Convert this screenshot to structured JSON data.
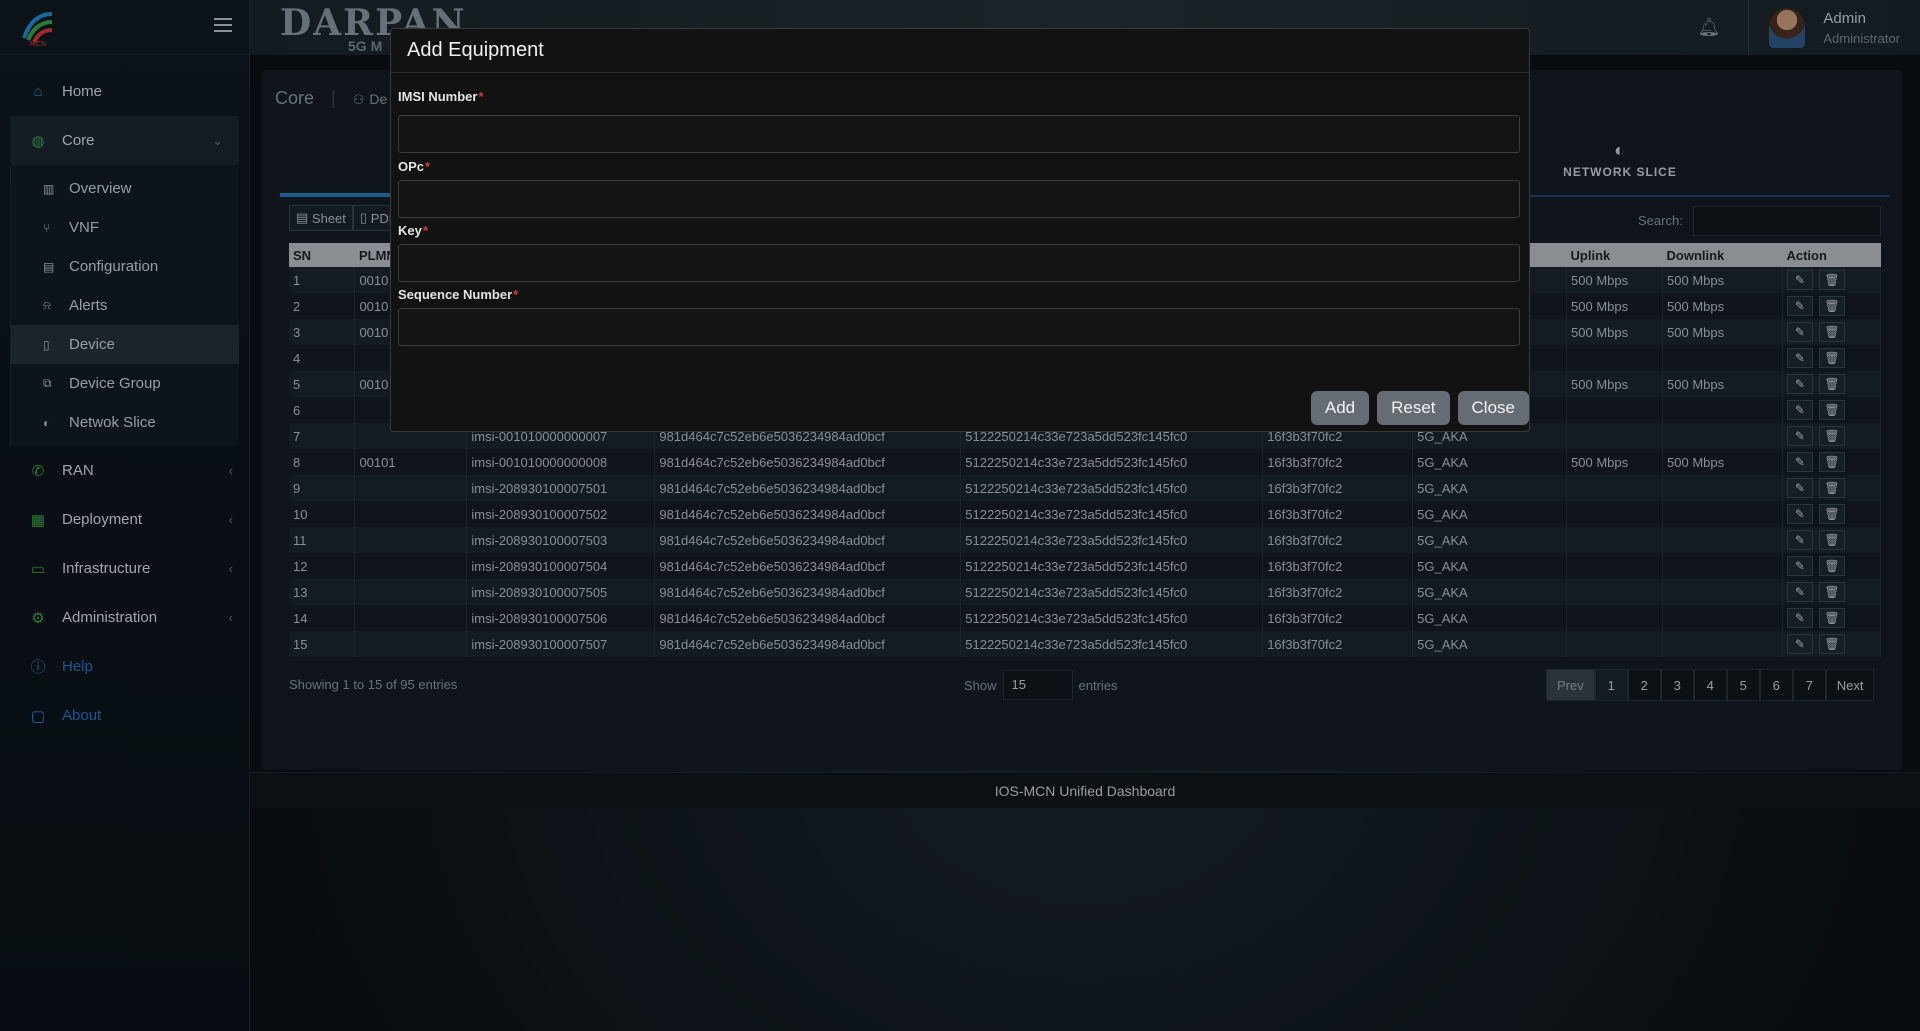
{
  "app": {
    "brand": "DARPAN",
    "brand_sub": "5G M",
    "logo_text": "MCN"
  },
  "sidebar": {
    "items": [
      {
        "label": "Home",
        "icon": "home-icon"
      },
      {
        "label": "Core",
        "icon": "globe-icon"
      },
      {
        "label": "RAN",
        "icon": "signal-icon"
      },
      {
        "label": "Deployment",
        "icon": "grid-icon"
      },
      {
        "label": "Infrastructure",
        "icon": "monitor-icon"
      },
      {
        "label": "Administration",
        "icon": "gear-icon"
      },
      {
        "label": "Help",
        "icon": "help-icon"
      },
      {
        "label": "About",
        "icon": "info-icon"
      }
    ],
    "core_sub": [
      {
        "label": "Overview"
      },
      {
        "label": "VNF"
      },
      {
        "label": "Configuration"
      },
      {
        "label": "Alerts"
      },
      {
        "label": "Device"
      },
      {
        "label": "Device Group"
      },
      {
        "label": "Netwok Slice"
      }
    ]
  },
  "user": {
    "name": "Admin",
    "role": "Administrator"
  },
  "page": {
    "breadcrumb_root": "Core",
    "breadcrumb_current": "De",
    "network_slice_tab": "NETWORK SLICE",
    "tool_sheet": "Sheet",
    "tool_pdf": "PDF",
    "search_label": "Search:"
  },
  "table": {
    "headers": [
      "SN",
      "PLMN",
      "",
      "",
      "",
      "",
      "",
      "Uplink",
      "Downlink",
      "Action"
    ],
    "rows": [
      [
        "1",
        "0010",
        "",
        "",
        "",
        "",
        "",
        "500 Mbps",
        "500 Mbps"
      ],
      [
        "2",
        "0010",
        "",
        "",
        "",
        "",
        "",
        "500 Mbps",
        "500 Mbps"
      ],
      [
        "3",
        "0010",
        "",
        "",
        "",
        "",
        "",
        "500 Mbps",
        "500 Mbps"
      ],
      [
        "4",
        "",
        "",
        "",
        "",
        "",
        "",
        "",
        ""
      ],
      [
        "5",
        "0010",
        "",
        "",
        "",
        "",
        "",
        "500 Mbps",
        "500 Mbps"
      ],
      [
        "6",
        "",
        "",
        "",
        "",
        "",
        "",
        "",
        ""
      ],
      [
        "7",
        "",
        "imsi-001010000000007",
        "981d464c7c52eb6e5036234984ad0bcf",
        "5122250214c33e723a5dd523fc145fc0",
        "16f3b3f70fc2",
        "5G_AKA",
        "",
        ""
      ],
      [
        "8",
        "00101",
        "imsi-001010000000008",
        "981d464c7c52eb6e5036234984ad0bcf",
        "5122250214c33e723a5dd523fc145fc0",
        "16f3b3f70fc2",
        "5G_AKA",
        "500 Mbps",
        "500 Mbps"
      ],
      [
        "9",
        "",
        "imsi-208930100007501",
        "981d464c7c52eb6e5036234984ad0bcf",
        "5122250214c33e723a5dd523fc145fc0",
        "16f3b3f70fc2",
        "5G_AKA",
        "",
        ""
      ],
      [
        "10",
        "",
        "imsi-208930100007502",
        "981d464c7c52eb6e5036234984ad0bcf",
        "5122250214c33e723a5dd523fc145fc0",
        "16f3b3f70fc2",
        "5G_AKA",
        "",
        ""
      ],
      [
        "11",
        "",
        "imsi-208930100007503",
        "981d464c7c52eb6e5036234984ad0bcf",
        "5122250214c33e723a5dd523fc145fc0",
        "16f3b3f70fc2",
        "5G_AKA",
        "",
        ""
      ],
      [
        "12",
        "",
        "imsi-208930100007504",
        "981d464c7c52eb6e5036234984ad0bcf",
        "5122250214c33e723a5dd523fc145fc0",
        "16f3b3f70fc2",
        "5G_AKA",
        "",
        ""
      ],
      [
        "13",
        "",
        "imsi-208930100007505",
        "981d464c7c52eb6e5036234984ad0bcf",
        "5122250214c33e723a5dd523fc145fc0",
        "16f3b3f70fc2",
        "5G_AKA",
        "",
        ""
      ],
      [
        "14",
        "",
        "imsi-208930100007506",
        "981d464c7c52eb6e5036234984ad0bcf",
        "5122250214c33e723a5dd523fc145fc0",
        "16f3b3f70fc2",
        "5G_AKA",
        "",
        ""
      ],
      [
        "15",
        "",
        "imsi-208930100007507",
        "981d464c7c52eb6e5036234984ad0bcf",
        "5122250214c33e723a5dd523fc145fc0",
        "16f3b3f70fc2",
        "5G_AKA",
        "",
        ""
      ]
    ],
    "info": "Showing 1 to 15 of 95 entries",
    "show_label": "Show",
    "entries_label": "entries",
    "page_size": "15",
    "pages": [
      "Prev",
      "1",
      "2",
      "3",
      "4",
      "5",
      "6",
      "7",
      "Next"
    ]
  },
  "footer": {
    "text": "IOS-MCN Unified Dashboard"
  },
  "modal": {
    "title": "Add Equipment",
    "fields": [
      {
        "label": "IMSI Number",
        "required": "*",
        "value": ""
      },
      {
        "label": "OPc",
        "required": "*",
        "value": ""
      },
      {
        "label": "Key",
        "required": "*",
        "value": ""
      },
      {
        "label": "Sequence Number",
        "required": "*",
        "value": ""
      }
    ],
    "buttons": {
      "add": "Add",
      "reset": "Reset",
      "close": "Close"
    }
  },
  "colors": {
    "accent": "#1f8dd6",
    "modal_bg": "#121212",
    "button_bg": "#666c73"
  }
}
